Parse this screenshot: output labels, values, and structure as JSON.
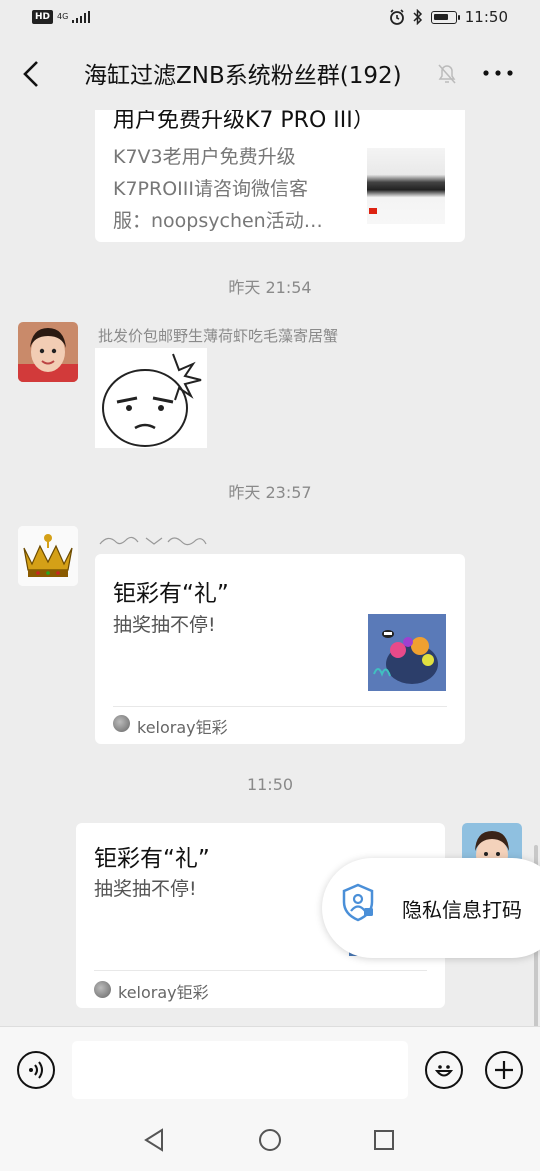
{
  "status": {
    "time": "11:50",
    "hd": "HD",
    "net": "4G"
  },
  "header": {
    "title": "海缸过滤ZNB系统粉丝群(192)"
  },
  "messages": {
    "card1": {
      "title_partial": "用户免费升级K7 PRO III）",
      "desc": [
        "K7V3老用户免费升级",
        "K7PROIII请咨询微信客",
        "服：noopsychen活动…"
      ]
    },
    "ts1": "昨天 21:54",
    "msg2": {
      "sender": "批发价包邮野生薄荷虾吃毛藻寄居蟹"
    },
    "ts2": "昨天 23:57",
    "msg3": {
      "card_title": "钜彩有“礼”",
      "card_desc": "抽奖抽不停!",
      "source": "keloray钜彩"
    },
    "ts3": "11:50",
    "msg4": {
      "card_title": "钜彩有“礼”",
      "card_desc": "抽奖抽不停!",
      "source": "keloray钜彩"
    }
  },
  "privacy": {
    "label": "隐私信息打码"
  },
  "colors": {
    "bg": "#ededed",
    "card": "#ffffff",
    "timestamp": "#8a8a8a"
  },
  "icons": [
    "back-icon",
    "mute-bell-icon",
    "more-icon",
    "voice-icon",
    "emoji-icon",
    "plus-icon",
    "shield-icon",
    "nav-back-icon",
    "nav-home-icon",
    "nav-recents-icon"
  ]
}
